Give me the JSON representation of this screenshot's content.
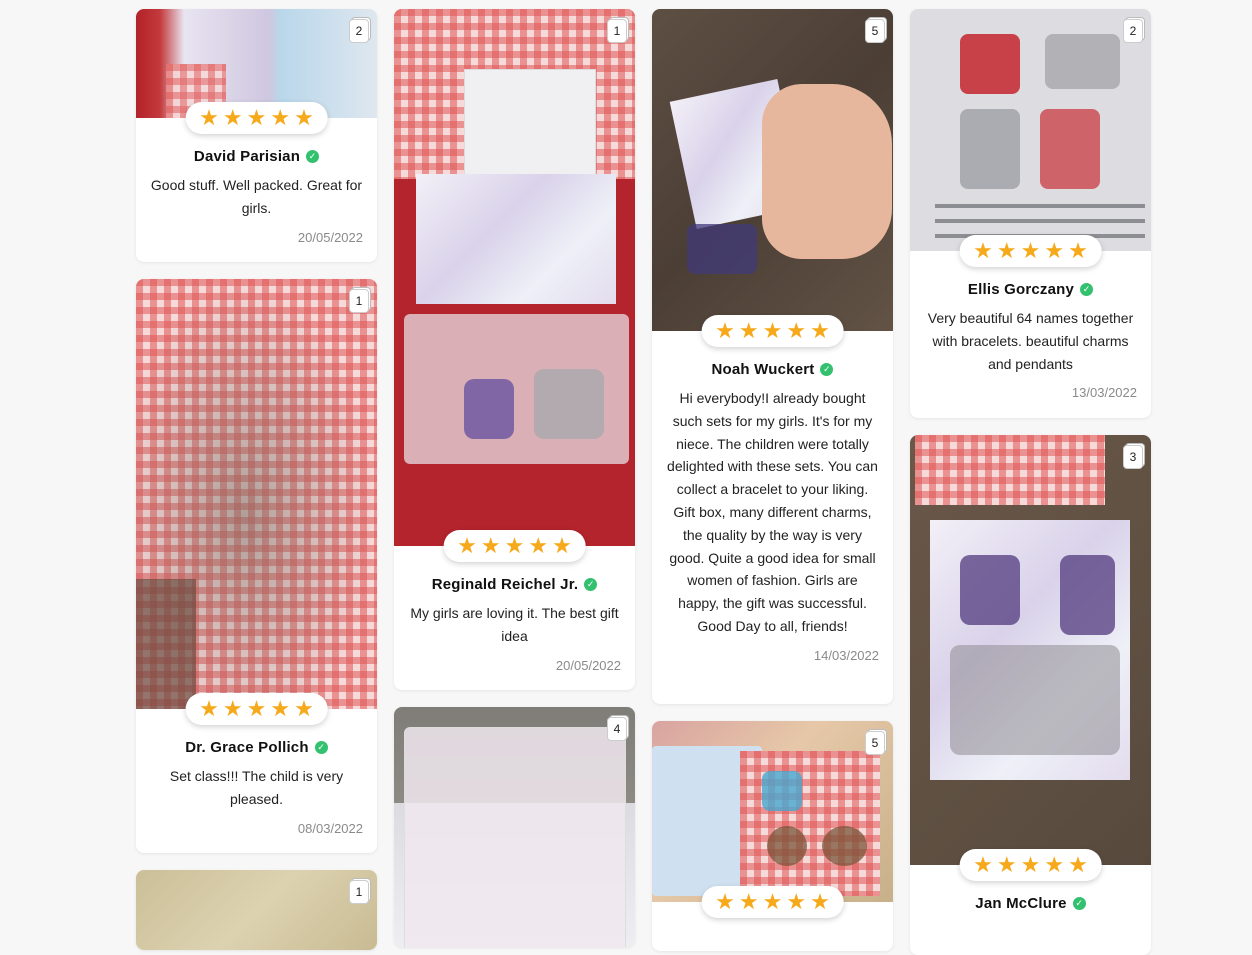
{
  "reviews": [
    {
      "name": "David Parisian",
      "text": "Good stuff. Well packed. Great for girls.",
      "date": "20/05/2022",
      "photo_count": "2",
      "rating": 5
    },
    {
      "name": "Dr. Grace Pollich",
      "text": "Set class!!! The child is very pleased.",
      "date": "08/03/2022",
      "photo_count": "1",
      "rating": 5
    },
    {
      "photo_count": "1"
    },
    {
      "name": "Reginald Reichel Jr.",
      "text": "My girls are loving it. The best gift idea",
      "date": "20/05/2022",
      "photo_count": "1",
      "rating": 5
    },
    {
      "photo_count": "4"
    },
    {
      "name": "Noah Wuckert",
      "text": "Hi everybody!I already bought such sets for my girls. It's for my niece. The children were totally delighted with these sets. You can collect a bracelet to your liking. Gift box, many different charms, the quality by the way is very good. Quite a good idea for small women of fashion. Girls are happy, the gift was successful. Good Day to all, friends!",
      "date": "14/03/2022",
      "photo_count": "5",
      "rating": 5
    },
    {
      "photo_count": "5",
      "rating": 5
    },
    {
      "name": "Ellis Gorczany",
      "text": "Very beautiful 64 names together with bracelets. beautiful charms and pendants",
      "date": "13/03/2022",
      "photo_count": "2",
      "rating": 5
    },
    {
      "name": "Jan McClure",
      "photo_count": "3",
      "rating": 5
    }
  ],
  "icons": {
    "star": "star-icon",
    "verified": "verified-check-icon",
    "photos": "photo-stack-icon"
  },
  "colors": {
    "star": "#f6a91b",
    "verified": "#33c16f",
    "date": "#8a8a8a"
  }
}
